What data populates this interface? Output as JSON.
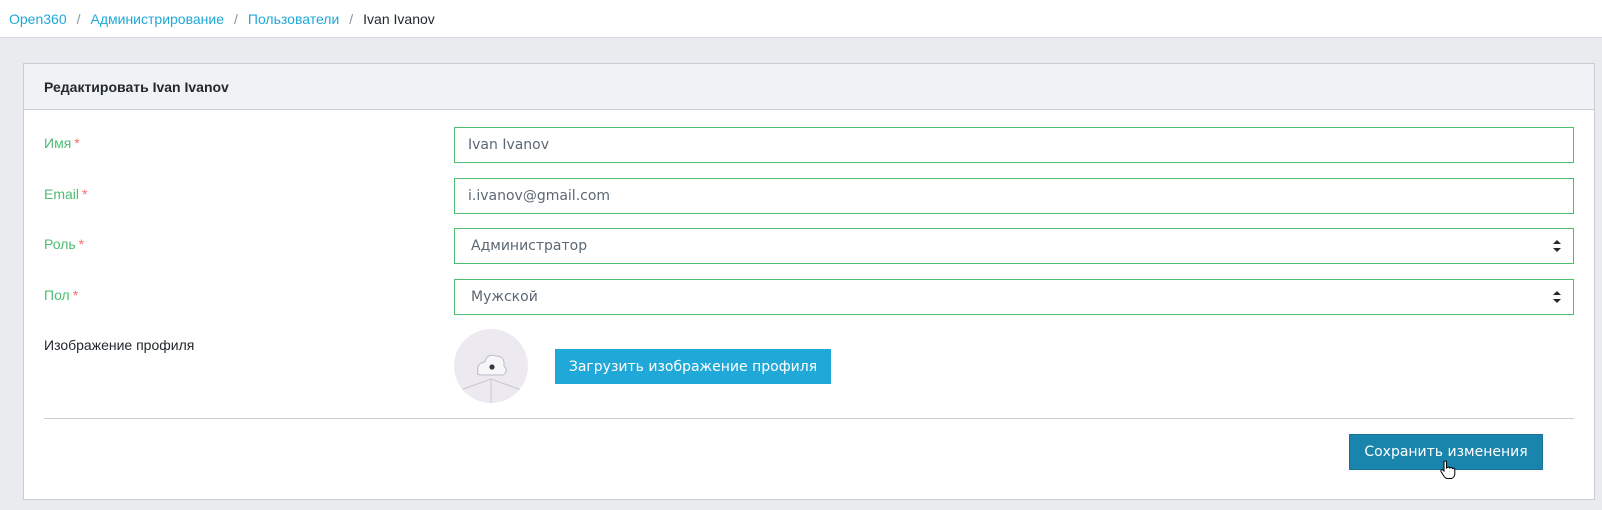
{
  "breadcrumb": {
    "items": [
      "Open360",
      "Администрирование",
      "Пользователи"
    ],
    "current": "Ivan Ivanov",
    "separator": "/"
  },
  "card": {
    "title": "Редактировать Ivan Ivanov"
  },
  "form": {
    "name": {
      "label": "Имя",
      "required_mark": "*",
      "value": "Ivan Ivanov"
    },
    "email": {
      "label": "Email",
      "required_mark": "*",
      "value": "i.ivanov@gmail.com"
    },
    "role": {
      "label": "Роль",
      "required_mark": "*",
      "value": "Администратор"
    },
    "gender": {
      "label": "Пол",
      "required_mark": "*",
      "value": "Мужской"
    },
    "avatar": {
      "label": "Изображение профиля",
      "upload_label": "Загрузить изображение профиля",
      "icon": "avatar-placeholder-icon"
    }
  },
  "actions": {
    "save_label": "Сохранить изменения"
  },
  "colors": {
    "link": "#20a8d8",
    "valid": "#4dbd74",
    "required": "#f86c6b",
    "primary_button": "#20a8d8",
    "save_button": "#1985ac"
  }
}
